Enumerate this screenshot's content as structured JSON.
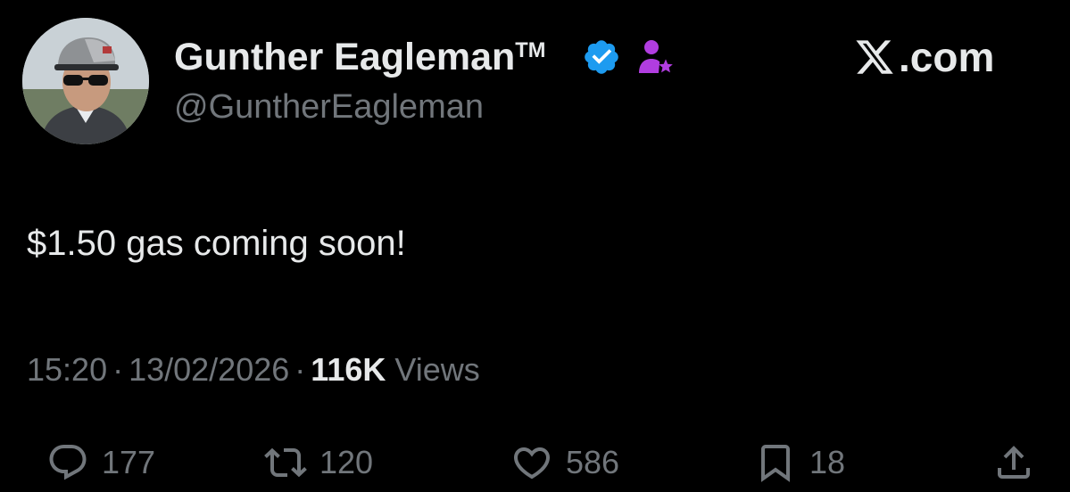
{
  "author": {
    "name": "Gunther Eagleman",
    "trademark": "TM",
    "handle": "@GuntherEagleman",
    "verified_icon": "verified-badge-icon",
    "affiliate_icon": "affiliate-person-star-icon",
    "avatar": "profile-photo"
  },
  "brand": {
    "icon": "x-logo-icon",
    "label": ".com"
  },
  "tweet": {
    "text": "$1.50 gas coming soon!"
  },
  "meta": {
    "time": "15:20",
    "separator": "·",
    "date": "13/02/2026",
    "views_count": "116K",
    "views_label": "Views"
  },
  "actions": {
    "replies": "177",
    "retweets": "120",
    "likes": "586",
    "bookmarks": "18"
  },
  "colors": {
    "background": "#000000",
    "text_primary": "#e7e9ea",
    "text_secondary": "#71767b",
    "verified_blue": "#1d9bf0",
    "affiliate_purple": "#b13de0"
  }
}
